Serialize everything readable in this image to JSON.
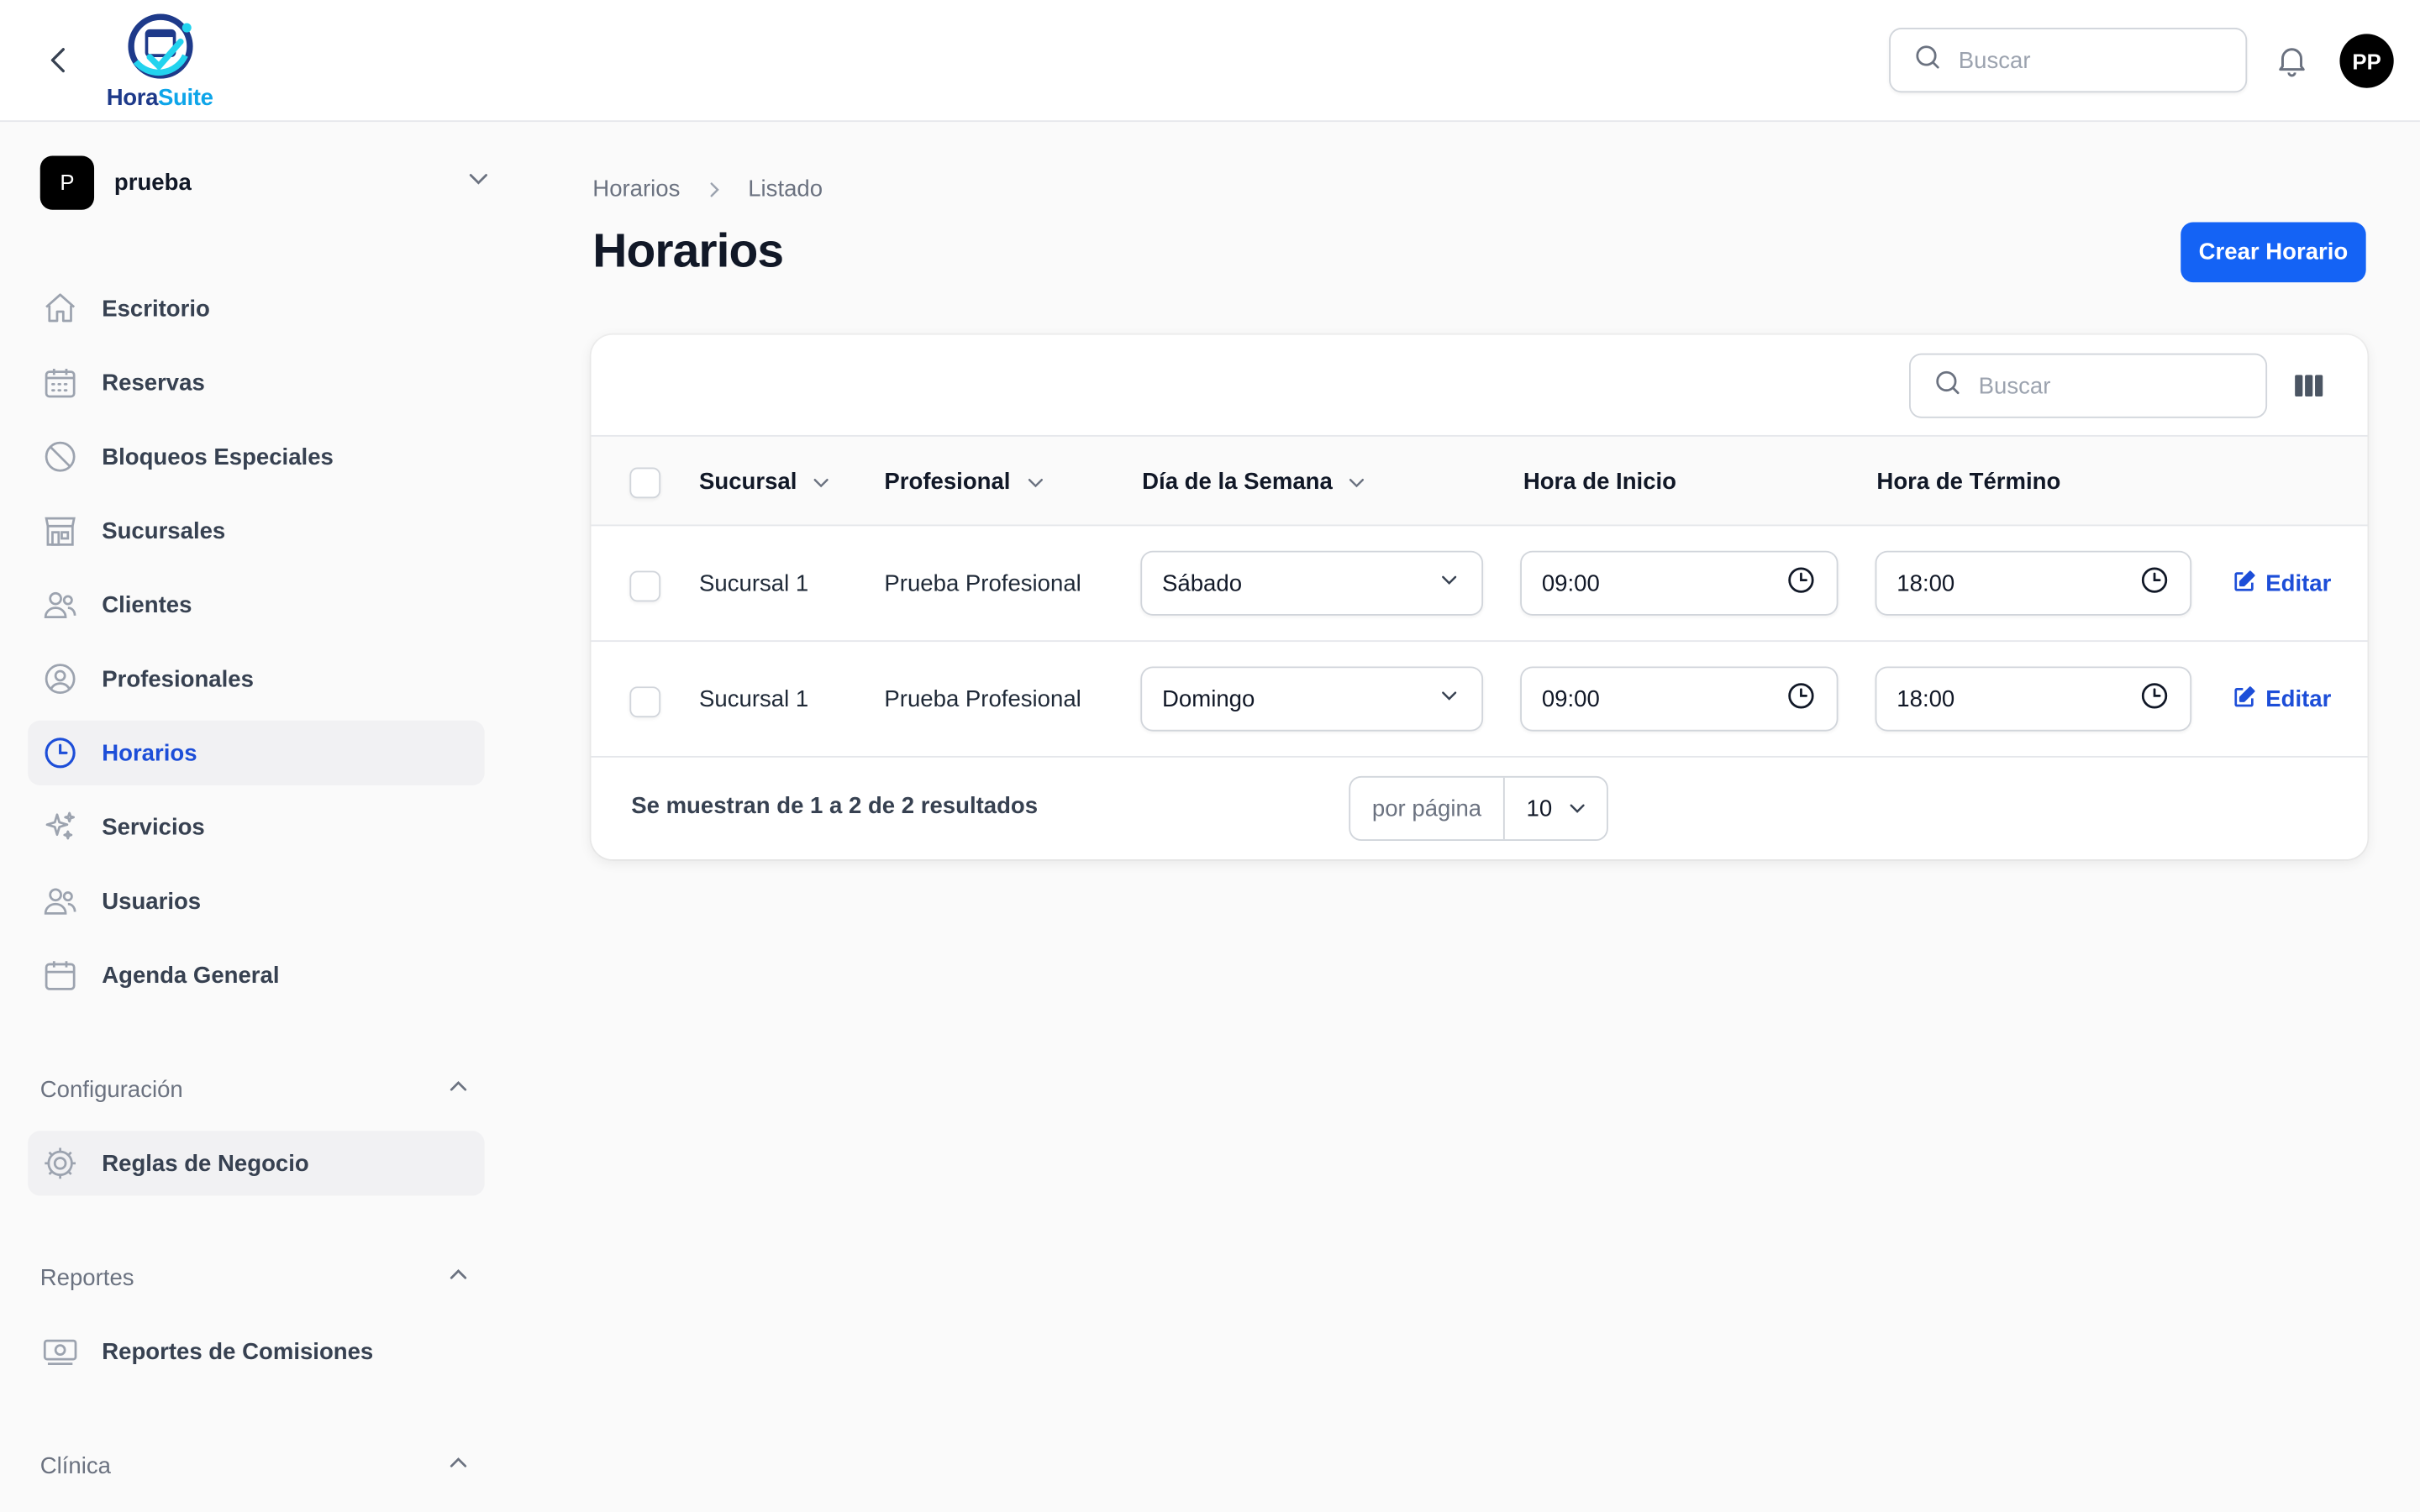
{
  "app": {
    "logo_part1": "Hora",
    "logo_part2": "Suite"
  },
  "topbar": {
    "search_placeholder": "Buscar",
    "avatar_initials": "PP"
  },
  "tenant": {
    "badge": "P",
    "name": "prueba"
  },
  "sidebar": {
    "items": [
      {
        "label": "Escritorio",
        "icon": "home-icon"
      },
      {
        "label": "Reservas",
        "icon": "calendar-grid-icon"
      },
      {
        "label": "Bloqueos Especiales",
        "icon": "ban-icon"
      },
      {
        "label": "Sucursales",
        "icon": "storefront-icon"
      },
      {
        "label": "Clientes",
        "icon": "users-icon"
      },
      {
        "label": "Profesionales",
        "icon": "user-circle-icon"
      },
      {
        "label": "Horarios",
        "icon": "clock-icon",
        "active": true
      },
      {
        "label": "Servicios",
        "icon": "sparkles-icon"
      },
      {
        "label": "Usuarios",
        "icon": "users-icon"
      },
      {
        "label": "Agenda General",
        "icon": "calendar-icon"
      }
    ],
    "groups": [
      {
        "label": "Configuración",
        "items": [
          {
            "label": "Reglas de Negocio",
            "icon": "cog-icon"
          }
        ]
      },
      {
        "label": "Reportes",
        "items": [
          {
            "label": "Reportes de Comisiones",
            "icon": "banknotes-icon"
          }
        ]
      },
      {
        "label": "Clínica",
        "items": []
      }
    ]
  },
  "breadcrumb": {
    "first": "Horarios",
    "second": "Listado"
  },
  "page": {
    "title": "Horarios",
    "create_label": "Crear Horario"
  },
  "table": {
    "search_placeholder": "Buscar",
    "columns": {
      "sucursal": "Sucursal",
      "profesional": "Profesional",
      "dia": "Día de la Semana",
      "inicio": "Hora de Inicio",
      "termino": "Hora de Término"
    },
    "rows": [
      {
        "sucursal": "Sucursal 1",
        "profesional": "Prueba Profesional",
        "dia": "Sábado",
        "inicio": "09:00",
        "termino": "18:00",
        "edit": "Editar"
      },
      {
        "sucursal": "Sucursal 1",
        "profesional": "Prueba Profesional",
        "dia": "Domingo",
        "inicio": "09:00",
        "termino": "18:00",
        "edit": "Editar"
      }
    ],
    "summary": "Se muestran de 1 a 2 de 2 resultados",
    "per_page_label": "por página",
    "per_page_value": "10"
  },
  "colors": {
    "accent": "#1463f5",
    "active_text": "#1d4ed8"
  }
}
